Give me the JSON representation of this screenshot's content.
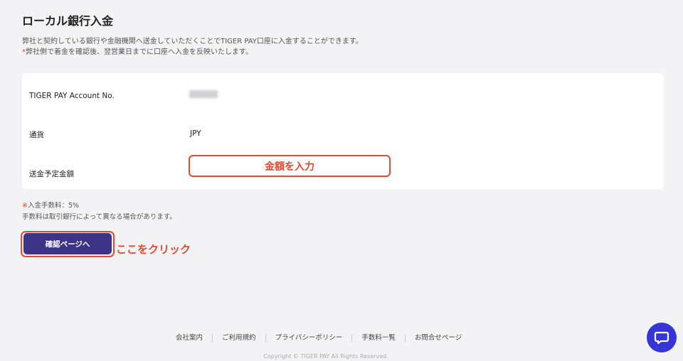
{
  "page": {
    "title": "ローカル銀行入金",
    "description_line1": "弊社と契約している銀行や金融機関へ送金していただくことでTIGER PAY口座に入金することができます。",
    "description_line2_mark": "*",
    "description_line2": "弊社側で着金を確認後、翌営業日までに口座へ入金を反映いたします。"
  },
  "form": {
    "account_label": "TIGER PAY Account No.",
    "currency_label": "通貨",
    "currency_value": "JPY",
    "amount_label": "送金予定金額",
    "amount_annotation": "金額を入力"
  },
  "fee": {
    "mark": "※",
    "line1": "入金手数料：5%",
    "line2": "手数料は取引銀行によって異なる場合があります。"
  },
  "actions": {
    "confirm_label": "確認ページへ",
    "click_hint": "ここをクリック"
  },
  "footer": {
    "links": [
      "会社案内",
      "ご利用規約",
      "プライバシーポリシー",
      "手数料一覧",
      "お問合せページ"
    ],
    "copyright": "Copyright © TIGER PAY All Rights Reserved."
  },
  "colors": {
    "accent": "#3c3487",
    "annotation": "#e24a31",
    "chat": "#3535d8"
  }
}
